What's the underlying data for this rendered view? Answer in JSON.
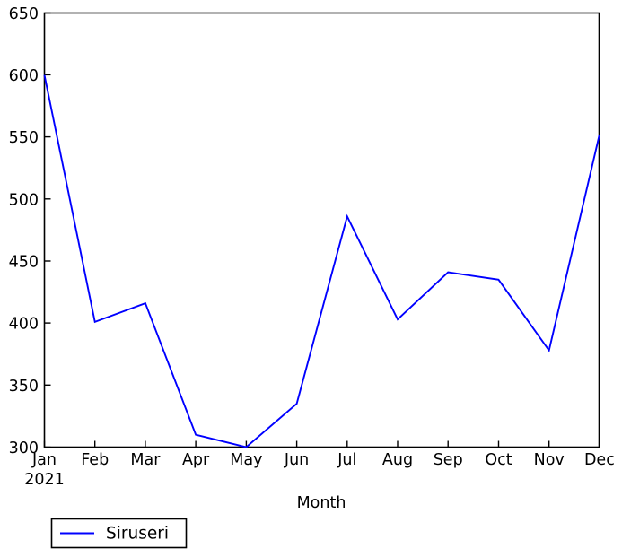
{
  "chart_data": {
    "type": "line",
    "title": "",
    "xlabel": "Month",
    "ylabel": "",
    "categories": [
      "Jan",
      "Feb",
      "Mar",
      "Apr",
      "May",
      "Jun",
      "Jul",
      "Aug",
      "Sep",
      "Oct",
      "Nov",
      "Dec"
    ],
    "x_period_label": "2021",
    "series": [
      {
        "name": "Siruseri",
        "color": "#0000ff",
        "values": [
          600,
          401,
          416,
          310,
          300,
          335,
          486,
          403,
          441,
          435,
          378,
          552
        ]
      }
    ],
    "ylim": [
      300,
      650
    ],
    "yticks": [
      300,
      350,
      400,
      450,
      500,
      550,
      600,
      650
    ],
    "ytick_labels": [
      "300",
      "350",
      "400",
      "450",
      "500",
      "550",
      "600",
      "650"
    ],
    "xtick_labels": [
      "Jan",
      "Feb",
      "Mar",
      "Apr",
      "May",
      "Jun",
      "Jul",
      "Aug",
      "Sep",
      "Oct",
      "Nov",
      "Dec"
    ],
    "grid": false,
    "legend_position": "below-left",
    "legend_entries": [
      "Siruseri"
    ]
  },
  "axes": {
    "x_axis_title": "Month",
    "x_year_label": "2021"
  },
  "legend": {
    "entries": [
      {
        "label": "Siruseri",
        "color": "#0000ff"
      }
    ]
  },
  "colors": {
    "series_blue": "#0000ff",
    "axis_black": "#000000",
    "background": "#ffffff"
  }
}
